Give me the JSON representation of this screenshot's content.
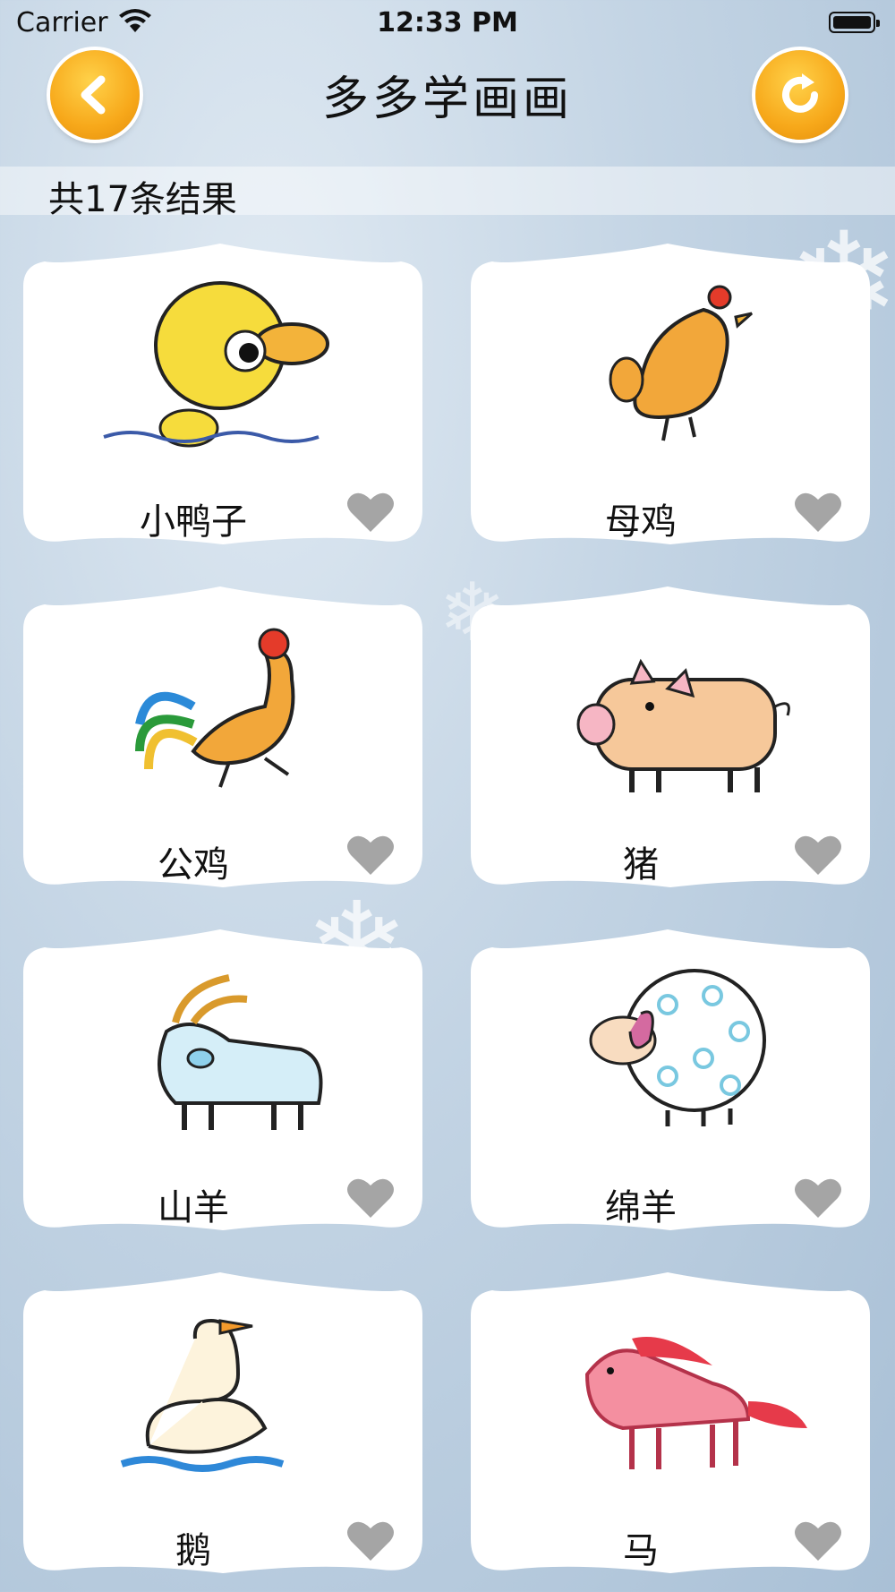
{
  "status_bar": {
    "carrier": "Carrier",
    "time": "12:33 PM"
  },
  "header": {
    "title": "多多学画画",
    "back_icon": "chevron-left-icon",
    "refresh_icon": "refresh-icon"
  },
  "results": {
    "text": "共17条结果"
  },
  "colors": {
    "button_orange": "#f7a81a",
    "heart_gray": "#a5a5a5",
    "card_white": "#ffffff"
  },
  "items": [
    {
      "name": "小鸭子",
      "icon": "duck"
    },
    {
      "name": "母鸡",
      "icon": "hen"
    },
    {
      "name": "公鸡",
      "icon": "rooster"
    },
    {
      "name": "猪",
      "icon": "pig"
    },
    {
      "name": "山羊",
      "icon": "goat"
    },
    {
      "name": "绵羊",
      "icon": "sheep"
    },
    {
      "name": "鹅",
      "icon": "goose"
    },
    {
      "name": "马",
      "icon": "horse"
    }
  ]
}
